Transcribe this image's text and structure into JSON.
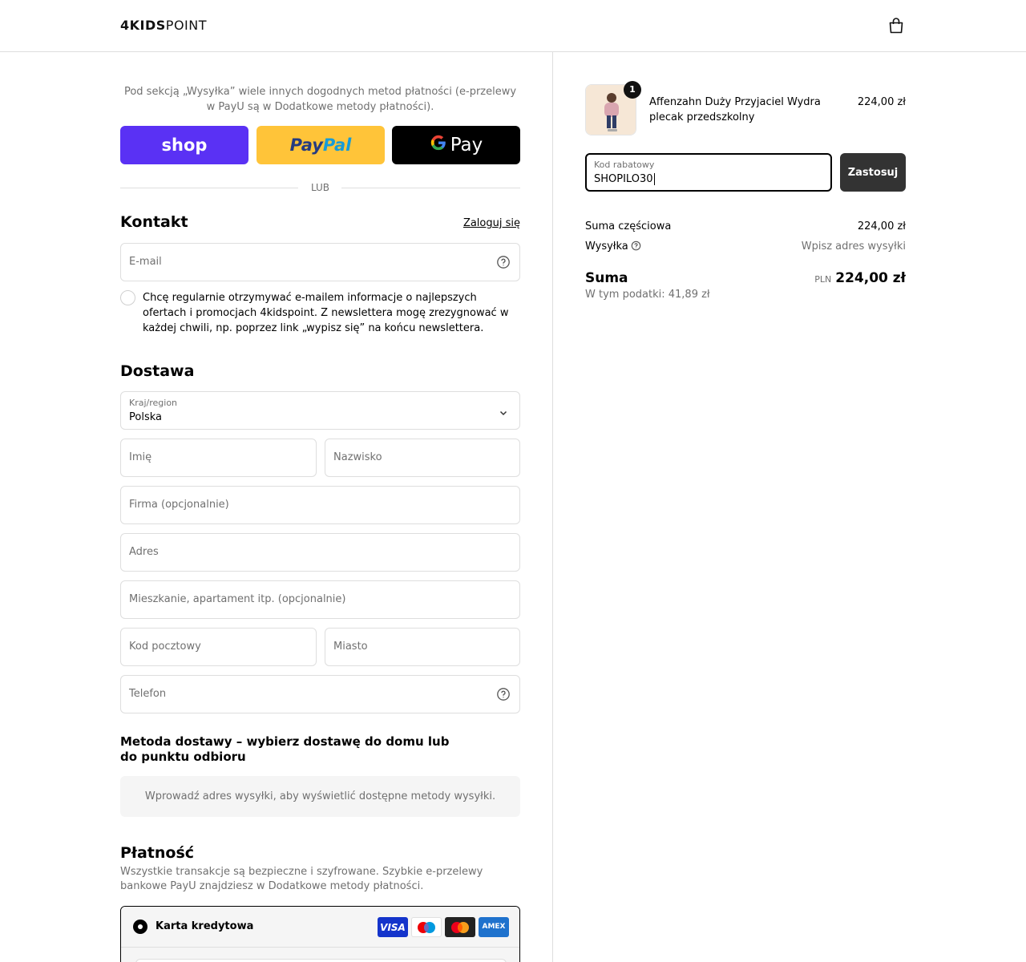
{
  "header": {
    "logo_bold": "4KIDS",
    "logo_light": "POINT",
    "cart_icon": "shopping-bag-icon"
  },
  "express": {
    "note": "Pod sekcją „Wysyłka” wiele innych dogodnych metod płatności (e-przelewy w PayU są w Dodatkowe metody płatności).",
    "shop_label": "shop",
    "paypal_part1": "Pay",
    "paypal_part2": "Pal",
    "gpay_label": "Pay",
    "separator": "LUB"
  },
  "contact": {
    "title": "Kontakt",
    "login_link": "Zaloguj się",
    "email_placeholder": "E-mail",
    "newsletter_text": "Chcę regularnie otrzymywać e-mailem informacje o najlepszych ofertach i promocjach 4kidspoint. Z newslettera mogę zrezygnować w każdej chwili, np. poprzez link „wypisz się” na końcu newslettera.",
    "newsletter_checked": false
  },
  "delivery": {
    "title": "Dostawa",
    "country_label": "Kraj/region",
    "country_value": "Polska",
    "first_name_placeholder": "Imię",
    "last_name_placeholder": "Nazwisko",
    "company_placeholder": "Firma (opcjonalnie)",
    "address_placeholder": "Adres",
    "apartment_placeholder": "Mieszkanie, apartament itp. (opcjonalnie)",
    "postal_placeholder": "Kod pocztowy",
    "city_placeholder": "Miasto",
    "phone_placeholder": "Telefon"
  },
  "shipping_method": {
    "title": "Metoda dostawy – wybierz dostawę do domu lub do punktu odbioru",
    "empty_message": "Wprowadź adres wysyłki, aby wyświetlić dostępne metody wysyłki."
  },
  "payment": {
    "title": "Płatność",
    "subtitle": "Wszystkie transakcje są bezpieczne i szyfrowane. Szybkie e-przelewy bankowe PayU znajdziesz w Dodatkowe metody płatności.",
    "option_label": "Karta kredytowa",
    "brands": [
      "VISA",
      "Maestro",
      "Mastercard",
      "AMEX"
    ]
  },
  "summary": {
    "product_name": "Affenzahn Duży Przyjaciel Wydra plecak przedszkolny",
    "product_price": "224,00 zł",
    "quantity": "1",
    "discount_label": "Kod rabatowy",
    "discount_value": "SHOPILO30",
    "apply_button": "Zastosuj",
    "subtotal_label": "Suma częściowa",
    "subtotal_value": "224,00 zł",
    "shipping_label": "Wysyłka",
    "shipping_value": "Wpisz adres wysyłki",
    "total_label": "Suma",
    "total_currency": "PLN",
    "total_value": "224,00 zł",
    "tax_note": "W tym podatki: 41,89 zł"
  },
  "colors": {
    "shop_pay": "#5a31f4",
    "paypal": "#ffc439",
    "gpay": "#000000",
    "apply_button": "#333333",
    "border": "#dedede",
    "muted_text": "#707070"
  }
}
